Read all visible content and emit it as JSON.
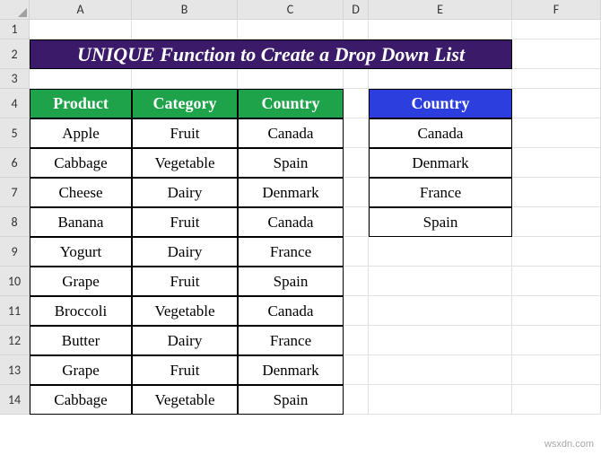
{
  "columns": [
    "A",
    "B",
    "C",
    "D",
    "E",
    "F"
  ],
  "rows": [
    "1",
    "2",
    "3",
    "4",
    "5",
    "6",
    "7",
    "8",
    "9",
    "10",
    "11",
    "12",
    "13",
    "14"
  ],
  "title": "UNIQUE Function to Create a Drop Down List",
  "main_table": {
    "headers": [
      "Product",
      "Category",
      "Country"
    ],
    "rows": [
      [
        "Apple",
        "Fruit",
        "Canada"
      ],
      [
        "Cabbage",
        "Vegetable",
        "Spain"
      ],
      [
        "Cheese",
        "Dairy",
        "Denmark"
      ],
      [
        "Banana",
        "Fruit",
        "Canada"
      ],
      [
        "Yogurt",
        "Dairy",
        "France"
      ],
      [
        "Grape",
        "Fruit",
        "Spain"
      ],
      [
        "Broccoli",
        "Vegetable",
        "Canada"
      ],
      [
        "Butter",
        "Dairy",
        "France"
      ],
      [
        "Grape",
        "Fruit",
        "Denmark"
      ],
      [
        "Cabbage",
        "Vegetable",
        "Spain"
      ]
    ]
  },
  "unique_table": {
    "header": "Country",
    "rows": [
      "Canada",
      "Denmark",
      "France",
      "Spain"
    ]
  },
  "watermark": "wsxdn.com"
}
